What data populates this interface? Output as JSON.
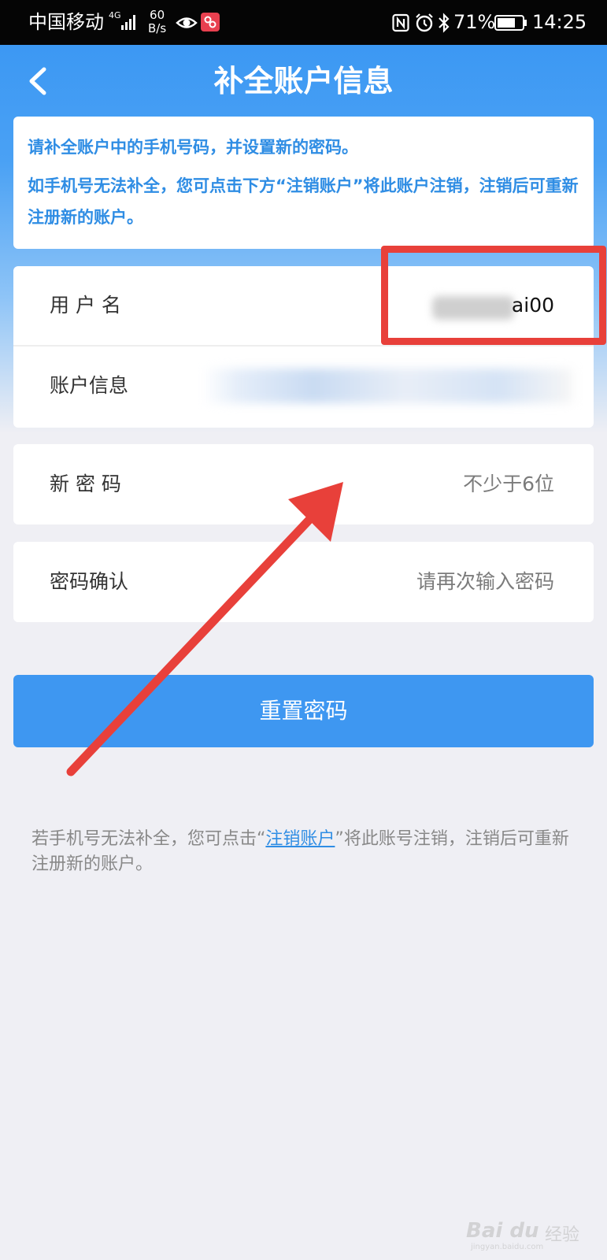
{
  "status_bar": {
    "carrier": "中国移动",
    "network": "4G",
    "speed": "60\nB/s",
    "battery": "71%",
    "time": "14:25"
  },
  "header": {
    "back_icon": "chevron-left-icon",
    "title": "补全账户信息"
  },
  "notice": {
    "line1": "请补全账户中的手机号码，并设置新的密码。",
    "line2": "如手机号无法补全，您可点击下方“注销账户”将此账户注销，注销后可重新注册新的账户。"
  },
  "form": {
    "username": {
      "label": "用 户 名",
      "value": "ai00"
    },
    "account": {
      "label": "账户信息"
    },
    "new_password": {
      "label": "新 密 码",
      "placeholder": "不少于6位"
    },
    "confirm_password": {
      "label": "密码确认",
      "placeholder": "请再次输入密码"
    }
  },
  "reset_button": {
    "label": "重置密码"
  },
  "footer": {
    "prefix": "若手机号无法补全，您可点击“",
    "link": "注销账户",
    "suffix": "”将此账号注销，注销后可重新注册新的账户。"
  },
  "watermark": {
    "brand": "Bai du",
    "product": "经验",
    "url": "jingyan.baidu.com"
  },
  "colors": {
    "primary": "#3e97f1",
    "annotation_red": "#e8403a",
    "notice_text": "#2f8de4",
    "background": "#efeff4"
  }
}
